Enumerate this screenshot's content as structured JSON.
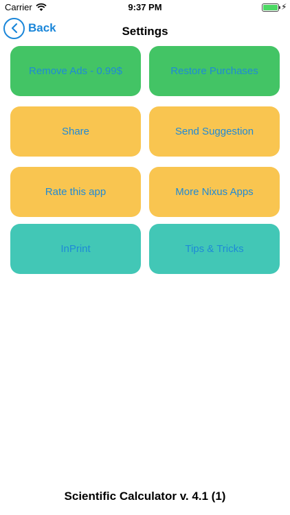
{
  "status_bar": {
    "carrier": "Carrier",
    "time": "9:37 PM",
    "battery_color": "#4cd964"
  },
  "nav": {
    "back_label": "Back",
    "title": "Settings",
    "accent": "#1a86d9"
  },
  "buttons": [
    {
      "label": "Remove Ads - 0.99$",
      "color": "#43c465"
    },
    {
      "label": "Restore Purchases",
      "color": "#43c465"
    },
    {
      "label": "Share",
      "color": "#f9c550"
    },
    {
      "label": "Send Suggestion",
      "color": "#f9c550"
    },
    {
      "label": "Rate this app",
      "color": "#f9c550"
    },
    {
      "label": "More Nixus Apps",
      "color": "#f9c550"
    },
    {
      "label": "InPrint",
      "color": "#42c7b6"
    },
    {
      "label": "Tips & Tricks",
      "color": "#42c7b6"
    }
  ],
  "footer": {
    "version": "Scientific Calculator v. 4.1 (1)"
  }
}
